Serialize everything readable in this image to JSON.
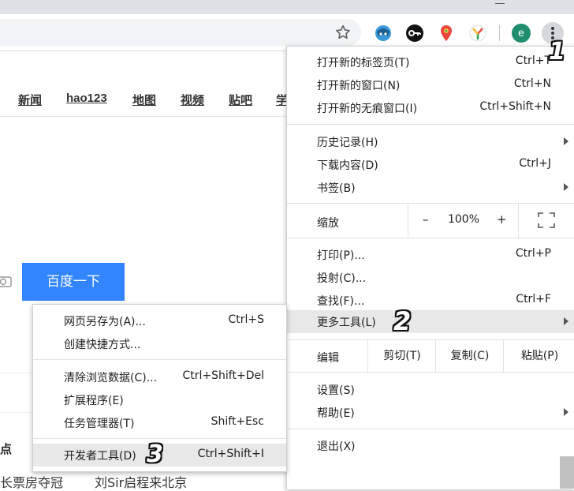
{
  "page": {
    "nav_links": [
      "新闻",
      "hao123",
      "地图",
      "视频",
      "贴吧",
      "学"
    ],
    "search_button": "百度一下",
    "news_heading": "点",
    "news_items": [
      "长票房夺冠",
      "刘Sir启程来北京"
    ]
  },
  "toolbar": {
    "profile_initial": "e",
    "icons": [
      "star-icon",
      "extension-anime-icon",
      "extension-key-icon",
      "extension-location-icon",
      "extension-y-icon",
      "avatar",
      "more-vert-icon"
    ]
  },
  "main_menu": {
    "new_tab": {
      "label": "打开新的标签页(T)",
      "shortcut": "Ctrl+T"
    },
    "new_window": {
      "label": "打开新的窗口(N)",
      "shortcut": "Ctrl+N"
    },
    "incognito": {
      "label": "打开新的无痕窗口(I)",
      "shortcut": "Ctrl+Shift+N"
    },
    "history": {
      "label": "历史记录(H)"
    },
    "downloads": {
      "label": "下载内容(D)",
      "shortcut": "Ctrl+J"
    },
    "bookmarks": {
      "label": "书签(B)"
    },
    "zoom": {
      "label": "缩放",
      "minus": "–",
      "value": "100%",
      "plus": "+"
    },
    "print": {
      "label": "打印(P)...",
      "shortcut": "Ctrl+P"
    },
    "cast": {
      "label": "投射(C)..."
    },
    "find": {
      "label": "查找(F)...",
      "shortcut": "Ctrl+F"
    },
    "more_tools": {
      "label": "更多工具(L)"
    },
    "edit": {
      "label": "编辑",
      "cut": "剪切(T)",
      "copy": "复制(C)",
      "paste": "粘贴(P)"
    },
    "settings": {
      "label": "设置(S)"
    },
    "help": {
      "label": "帮助(E)"
    },
    "exit": {
      "label": "退出(X)"
    }
  },
  "sub_menu": {
    "save_page": {
      "label": "网页另存为(A)...",
      "shortcut": "Ctrl+S"
    },
    "create_shortcut": {
      "label": "创建快捷方式..."
    },
    "clear_data": {
      "label": "清除浏览数据(C)...",
      "shortcut": "Ctrl+Shift+Del"
    },
    "extensions": {
      "label": "扩展程序(E)"
    },
    "task_manager": {
      "label": "任务管理器(T)",
      "shortcut": "Shift+Esc"
    },
    "dev_tools": {
      "label": "开发者工具(D)",
      "shortcut": "Ctrl+Shift+I"
    }
  },
  "annotations": [
    "1",
    "2",
    "3"
  ],
  "colors": {
    "search_button": "#3385ff",
    "highlight": "#e8e8e8",
    "avatar": "#1e8e6e"
  }
}
